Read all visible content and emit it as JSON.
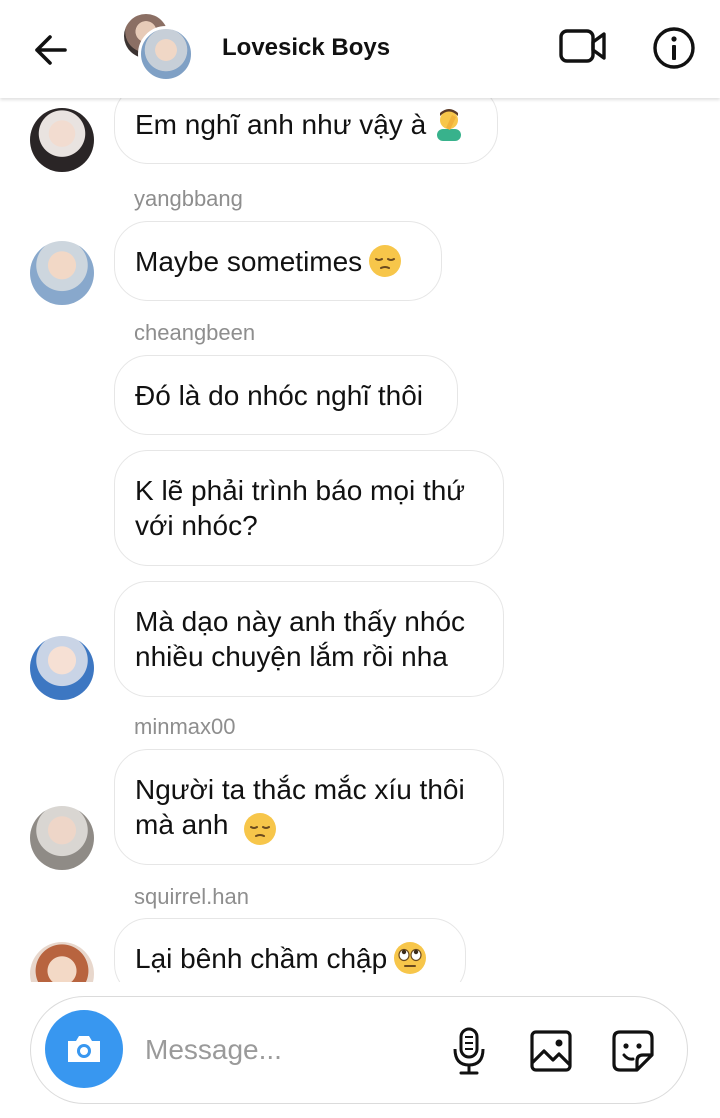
{
  "header": {
    "title": "Lovesick Boys",
    "back_icon": "arrow-left-icon",
    "video_icon": "video-camera-icon",
    "info_icon": "info-icon"
  },
  "messages": [
    {
      "text": "Em nghĩ anh như vậy à",
      "emoji": "person-facepalming"
    },
    {
      "sender": "yangbbang",
      "text": "Maybe sometimes",
      "emoji": "pensive-face"
    },
    {
      "sender": "cheangbeen",
      "text": "Đó là do nhóc nghĩ thôi"
    },
    {
      "text": "K lẽ phải trình báo mọi thứ\nvới nhóc?"
    },
    {
      "text": "Mà dạo này anh thấy nhóc\nnhiều chuyện lắm rồi nha"
    },
    {
      "sender": "minmax00",
      "text": "Người ta thắc mắc xíu thôi\nmà anh",
      "emoji": "pensive-face"
    },
    {
      "sender": "squirrel.han",
      "text": "Lại bênh chầm chập",
      "emoji": "face-with-rolling-eyes"
    }
  ],
  "composer": {
    "placeholder": "Message...",
    "camera_icon": "camera-icon",
    "mic_icon": "microphone-icon",
    "gallery_icon": "image-icon",
    "sticker_icon": "sticker-icon"
  },
  "colors": {
    "accent": "#3897f0",
    "bubble_border": "#e6e6e6",
    "sender_text": "#8e8e8e"
  }
}
